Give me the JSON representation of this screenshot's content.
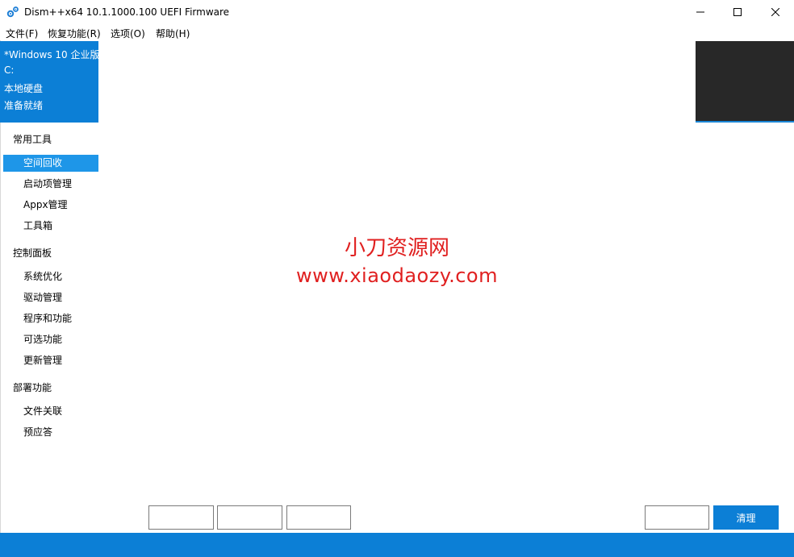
{
  "window": {
    "title": "Dism++x64 10.1.1000.100 UEFI Firmware",
    "icon": "gear-icon",
    "controls": [
      "minimize-icon",
      "maximize-icon",
      "close-icon"
    ]
  },
  "menu": [
    "文件(F)",
    "恢复功能(R)",
    "选项(O)",
    "帮助(H)"
  ],
  "info_panel": {
    "os": "*Windows 10 企业版",
    "drive": "C:",
    "disk": "本地硬盘",
    "status": "准备就绪",
    "background": "#0c7fd6"
  },
  "sidebar": {
    "groups": [
      {
        "title": "常用工具",
        "items": [
          "空间回收",
          "启动项管理",
          "Appx管理",
          "工具箱"
        ]
      },
      {
        "title": "控制面板",
        "items": [
          "系统优化",
          "驱动管理",
          "程序和功能",
          "可选功能",
          "更新管理"
        ]
      },
      {
        "title": "部署功能",
        "items": [
          "文件关联",
          "预应答"
        ]
      }
    ],
    "selected": "空间回收",
    "selected_color": "#1e96e8"
  },
  "watermark": {
    "line1": "小刀资源网",
    "line2": "www.xiaodaozy.com",
    "color": "#e02020"
  },
  "buttons": {
    "clean": "清理"
  },
  "colors": {
    "accent": "#0c7fd6",
    "dark_panel": "#282828"
  }
}
